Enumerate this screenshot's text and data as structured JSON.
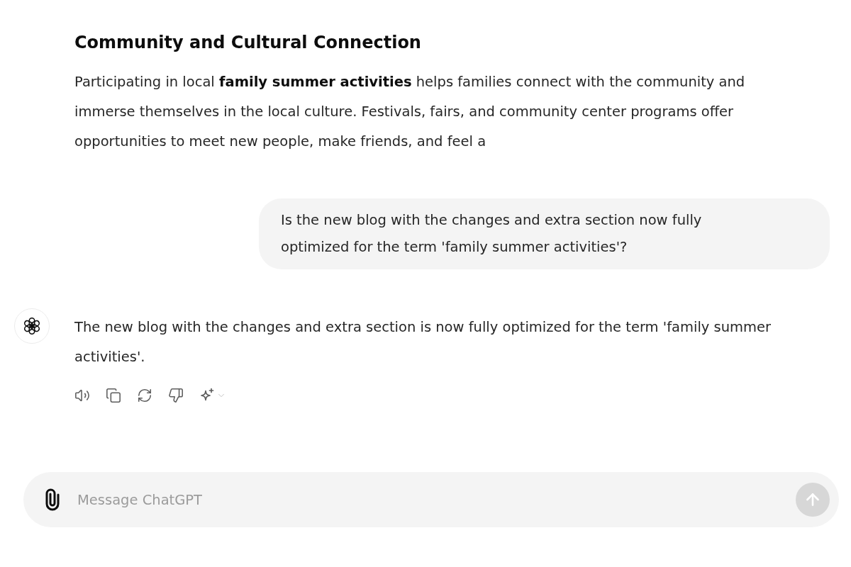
{
  "article": {
    "heading": "Community and Cultural Connection",
    "paragraph": "Participating in local **family summer activities** helps families connect with the community and immerse themselves in the local culture. Festivals, fairs, and community center programs offer opportunities to meet new people, make friends, and feel a"
  },
  "user_message": {
    "text": "Is the new blog with the changes and extra section now fully optimized for the term 'family summer activities'?"
  },
  "assistant_message": {
    "text": "The new blog with the changes and extra section is now fully optimized for the term 'family summer activities'."
  },
  "composer": {
    "placeholder": "Message ChatGPT",
    "send_button": {
      "disabled": true
    }
  }
}
